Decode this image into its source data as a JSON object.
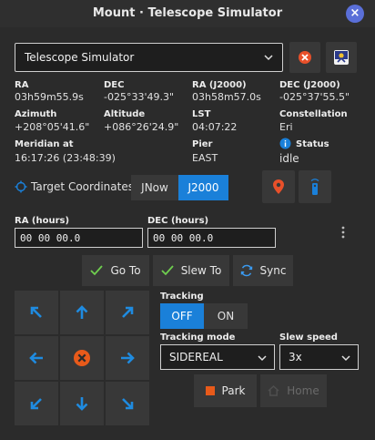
{
  "window": {
    "title": "Mount · Telescope Simulator",
    "close_glyph": "×"
  },
  "device": {
    "selected": "Telescope Simulator"
  },
  "coords": {
    "ra": {
      "label": "RA",
      "value": "03h59m55.9s"
    },
    "dec": {
      "label": "DEC",
      "value": "-025°33'49.3\""
    },
    "ra_j2000": {
      "label": "RA (J2000)",
      "value": "03h58m57.0s"
    },
    "dec_j2000": {
      "label": "DEC (J2000)",
      "value": "-025°37'55.5\""
    },
    "azimuth": {
      "label": "Azimuth",
      "value": "+208°05'41.6\""
    },
    "altitude": {
      "label": "Altitude",
      "value": "+086°26'24.9\""
    },
    "lst": {
      "label": "LST",
      "value": "04:07:22"
    },
    "constellation": {
      "label": "Constellation",
      "value": "Eri"
    },
    "meridian": {
      "label": "Meridian at",
      "value": "16:17:26 (23:48:39)"
    },
    "pier": {
      "label": "Pier",
      "value": "EAST"
    },
    "status": {
      "label": "Status",
      "value": "idle"
    }
  },
  "target": {
    "label": "Target Coordinates:",
    "epochs": [
      "JNow",
      "J2000"
    ],
    "selected_epoch": "J2000"
  },
  "inputs": {
    "ra_label": "RA (hours)",
    "ra_value": "00 00 00.0",
    "dec_label": "DEC (hours)",
    "dec_value": "00 00 00.0"
  },
  "actions": {
    "goto": "Go To",
    "slew": "Slew To",
    "sync": "Sync"
  },
  "tracking": {
    "label": "Tracking",
    "off": "OFF",
    "on": "ON",
    "state": "OFF",
    "mode_label": "Tracking mode",
    "mode": "SIDEREAL",
    "speed_label": "Slew speed",
    "speed": "3x"
  },
  "park": {
    "park": "Park",
    "home": "Home"
  },
  "colors": {
    "accent": "#1a80d9",
    "danger": "#e8502a",
    "stop": "#e85a1a"
  }
}
